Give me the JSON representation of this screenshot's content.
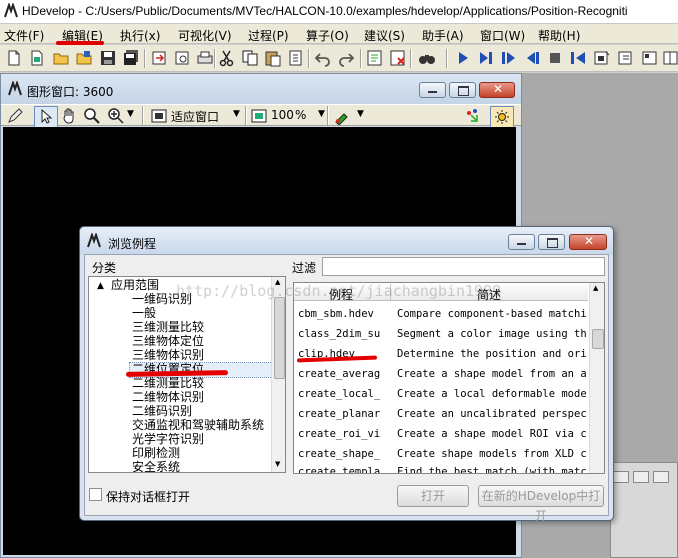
{
  "window": {
    "title": "HDevelop - C:/Users/Public/Documents/MVTec/HALCON-10.0/examples/hdevelop/Applications/Position-Recogniti"
  },
  "menu": [
    {
      "label": "文件(F)"
    },
    {
      "label": "编辑(E)"
    },
    {
      "label": "执行(x)"
    },
    {
      "label": "可视化(V)"
    },
    {
      "label": "过程(P)"
    },
    {
      "label": "算子(O)"
    },
    {
      "label": "建议(S)"
    },
    {
      "label": "助手(A)"
    },
    {
      "label": "窗口(W)"
    },
    {
      "label": "帮助(H)"
    }
  ],
  "graphics_window": {
    "title": "图形窗口: 3600",
    "fit_label": "适应窗口",
    "zoom_value": "100",
    "zoom_unit": "%"
  },
  "dialog": {
    "title": "浏览例程",
    "category_label": "分类",
    "filter_label": "过滤",
    "filter_value": "",
    "tree_root": "应用范围",
    "tree_items": [
      "一维码识别",
      "一般",
      "三维测量比较",
      "三维物体定位",
      "三维物体识别",
      "二维位置定位",
      "二维测量比较",
      "二维物体识别",
      "二维码识别",
      "交通监视和驾驶辅助系统",
      "光学字符识别",
      "印刷检测",
      "安全系统"
    ],
    "table_headers": [
      "例程",
      "简述"
    ],
    "rows": [
      {
        "name": "cbm_sbm.hdev",
        "desc": "Compare component-based matchi"
      },
      {
        "name": "class_2dim_su",
        "desc": "Segment a color image using th"
      },
      {
        "name": "clip.hdev",
        "desc": "Determine the position and ori"
      },
      {
        "name": "create_averag",
        "desc": "Create a shape model from an a"
      },
      {
        "name": "create_local_",
        "desc": "Create a local deformable mode"
      },
      {
        "name": "create_planar",
        "desc": "Create an uncalibrated perspec"
      },
      {
        "name": "create_roi_vi",
        "desc": "Create a shape model ROI via c"
      },
      {
        "name": "create_shape_",
        "desc": "Create shape models from XLD c"
      },
      {
        "name": "create_templa",
        "desc": "Find the best match (with matc"
      }
    ],
    "keep_open_label": "保持对话框打开",
    "open_button": "打开",
    "open_new_button": "在新的HDevelop中打开"
  },
  "watermark": "http://blog.csdn.net/jiachangbin1989",
  "colors": {
    "annotation_red": "#e40000",
    "canvas": "#000000"
  }
}
